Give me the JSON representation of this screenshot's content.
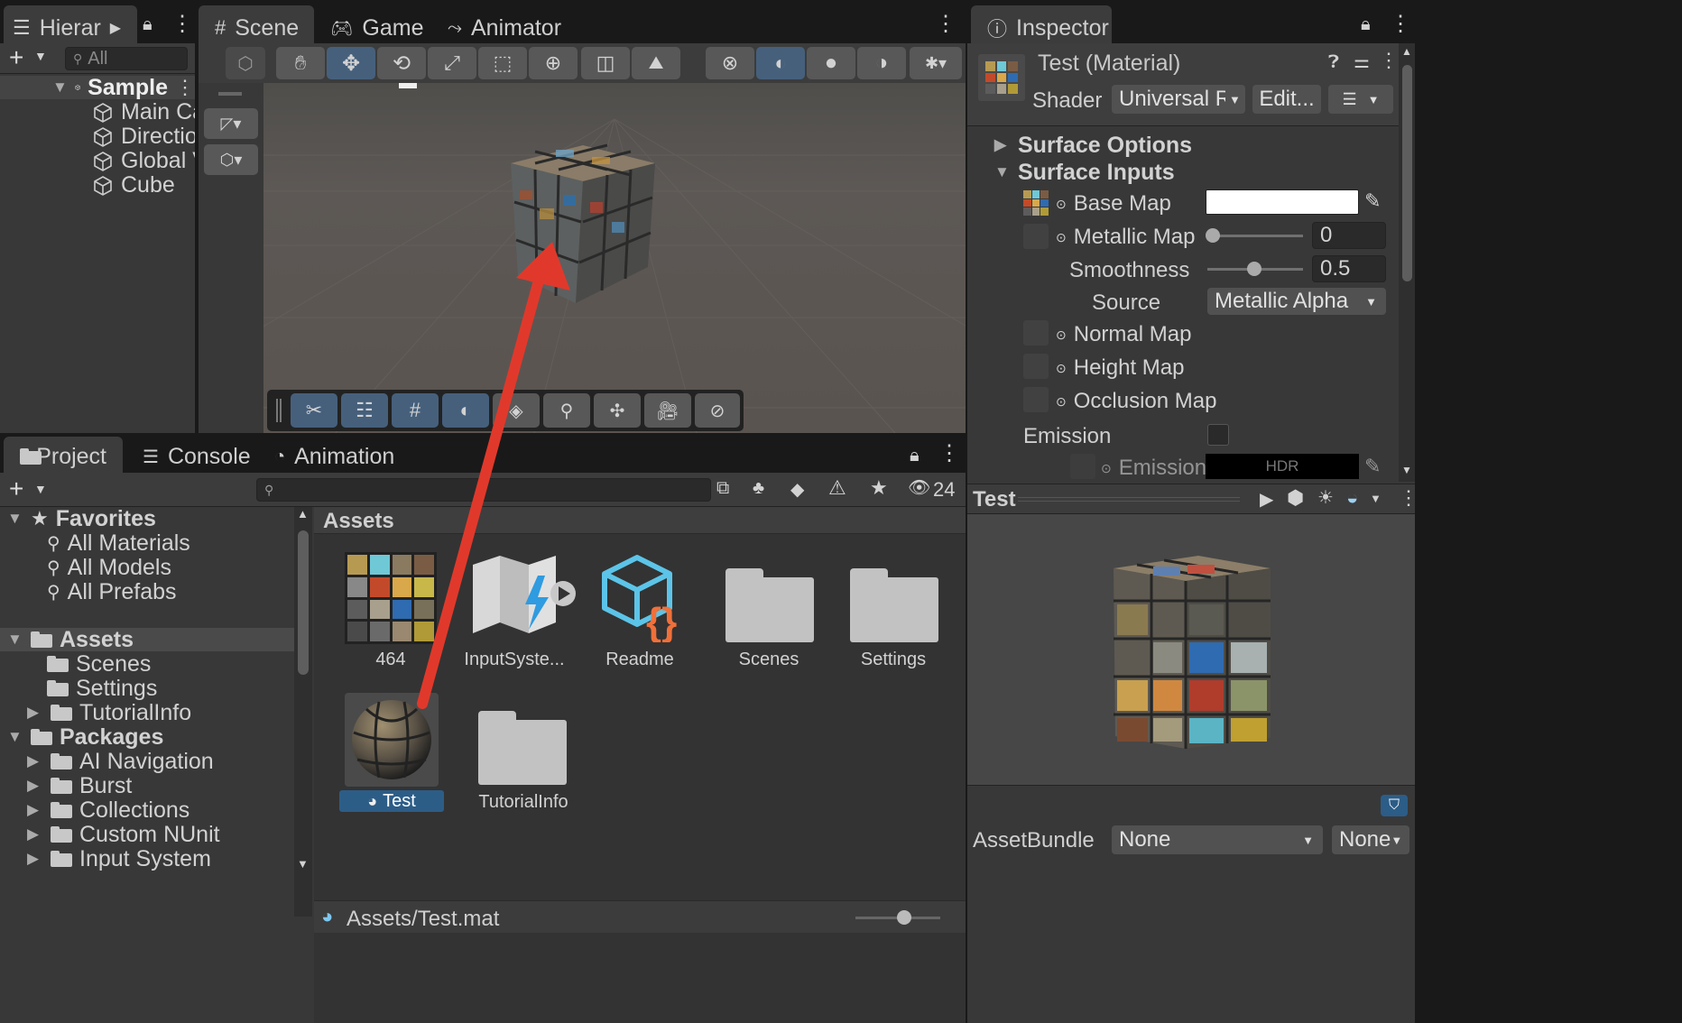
{
  "hierarchy": {
    "tab_label": "Hierarchy",
    "search_placeholder": "All",
    "scene_name": "Sample",
    "items": [
      "Main Camera",
      "Directional Light",
      "Global Volume",
      "Cube"
    ]
  },
  "scene_view": {
    "tabs": [
      "Scene",
      "Game",
      "Animator"
    ]
  },
  "project": {
    "tabs": [
      "Project",
      "Console",
      "Animation"
    ],
    "hidden_count": "24",
    "favorites": {
      "label": "Favorites",
      "items": [
        "All Materials",
        "All Models",
        "All Prefabs"
      ]
    },
    "assets": {
      "label": "Assets",
      "items": [
        "Scenes",
        "Settings",
        "TutorialInfo"
      ]
    },
    "packages": {
      "label": "Packages",
      "items": [
        "AI Navigation",
        "Burst",
        "Collections",
        "Custom NUnit",
        "Input System"
      ]
    },
    "content_header": "Assets",
    "grid_items": [
      "464",
      "InputSyste...",
      "Readme",
      "Scenes",
      "Settings",
      "Test",
      "TutorialInfo"
    ],
    "footer_path": "Assets/Test.mat",
    "zoom_level": 0.6
  },
  "inspector": {
    "tab_label": "Inspector",
    "title": "Test (Material)",
    "shader_label": "Shader",
    "shader_value": "Universal Render Pipeline/Lit",
    "edit_button": "Edit...",
    "sections": {
      "surface_options": "Surface Options",
      "surface_inputs": "Surface Inputs"
    },
    "base_map": "Base Map",
    "metallic_map": "Metallic Map",
    "metallic_value": "0",
    "smoothness_label": "Smoothness",
    "smoothness_value": "0.5",
    "source_label": "Source",
    "source_value": "Metallic Alpha",
    "normal_map": "Normal Map",
    "height_map": "Height Map",
    "occlusion_map": "Occlusion Map",
    "emission_label": "Emission",
    "emission_map": "Emission Map",
    "hdr_label": "HDR",
    "preview_title": "Test",
    "assetbundle_label": "AssetBundle",
    "assetbundle_name": "None",
    "assetbundle_variant": "None"
  },
  "colors": {
    "accent_blue": "#2c5d87",
    "arrow_red": "#e0392b",
    "panel_bg": "#383838",
    "dark_bg": "#191919"
  }
}
